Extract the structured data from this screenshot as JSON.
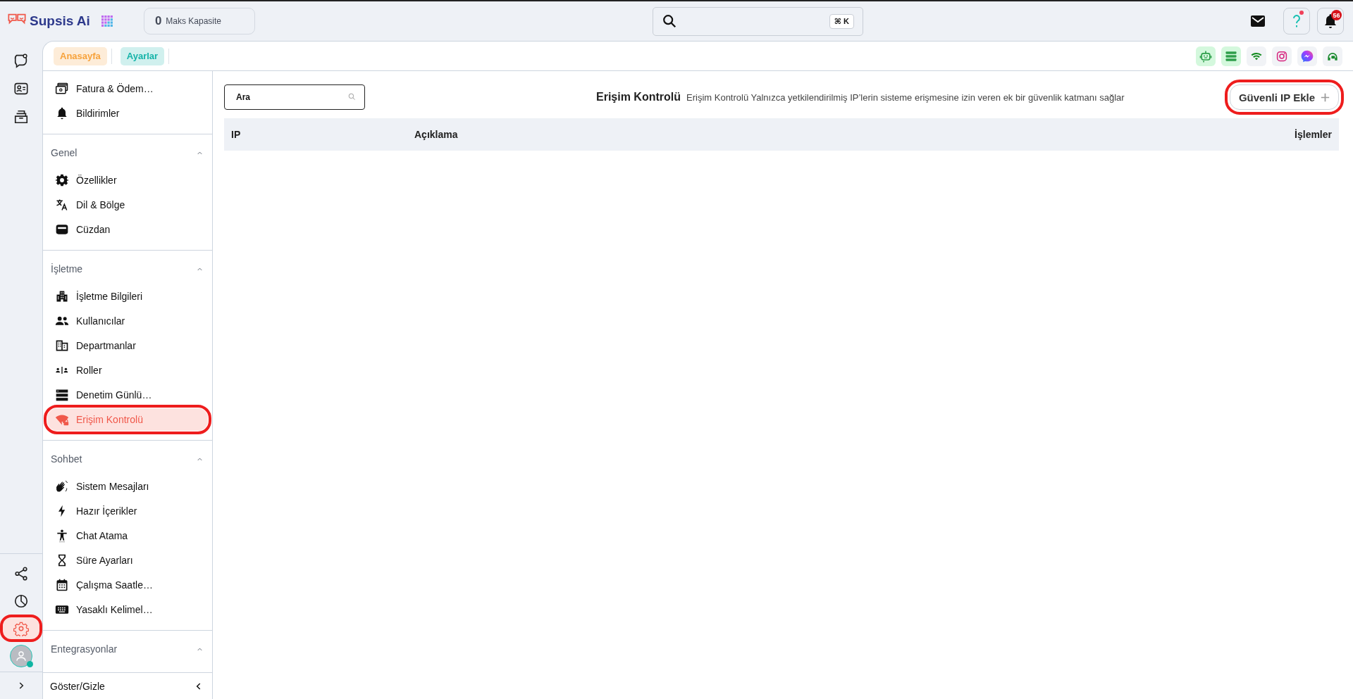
{
  "brand": {
    "name": "Supsis Ai"
  },
  "capacity": {
    "count": "0",
    "label": "Maks Kapasite"
  },
  "global_search": {
    "shortcut": "⌘ K"
  },
  "help": {
    "unread": true
  },
  "notifications": {
    "badge": "56"
  },
  "rail": {
    "top_items": [
      {
        "selected": false
      },
      {
        "selected": false
      },
      {
        "selected": false
      }
    ],
    "bottom_items": [
      {
        "selected": false,
        "highlighted": false
      },
      {
        "selected": false,
        "highlighted": false
      },
      {
        "selected": true,
        "highlighted": true
      }
    ],
    "user": {
      "online": true
    }
  },
  "breadcrumbs": [
    {
      "label": "Anasayfa",
      "color": "#f7a23b"
    },
    {
      "label": "Ayarlar",
      "color": "#14b3a8"
    }
  ],
  "channels": [
    {
      "active": true
    },
    {
      "active": true
    },
    {
      "active": false
    },
    {
      "active": false
    },
    {
      "active": false
    },
    {
      "active": false
    }
  ],
  "sidebar": {
    "pinned_items": [
      {
        "label": "Fatura & Ödem…",
        "selected": false,
        "highlighted": false
      },
      {
        "label": "Bildirimler",
        "selected": false,
        "highlighted": false
      }
    ],
    "sections": [
      {
        "title": "Genel",
        "expanded": true,
        "items": [
          {
            "label": "Özellikler",
            "selected": false,
            "highlighted": false
          },
          {
            "label": "Dil & Bölge",
            "selected": false,
            "highlighted": false
          },
          {
            "label": "Cüzdan",
            "selected": false,
            "highlighted": false
          }
        ]
      },
      {
        "title": "İşletme",
        "expanded": true,
        "items": [
          {
            "label": "İşletme Bilgileri",
            "selected": false,
            "highlighted": false
          },
          {
            "label": "Kullanıcılar",
            "selected": false,
            "highlighted": false
          },
          {
            "label": "Departmanlar",
            "selected": false,
            "highlighted": false
          },
          {
            "label": "Roller",
            "selected": false,
            "highlighted": false
          },
          {
            "label": "Denetim Günlü…",
            "selected": false,
            "highlighted": false
          },
          {
            "label": "Erişim Kontrolü",
            "selected": true,
            "highlighted": true
          }
        ]
      },
      {
        "title": "Sohbet",
        "expanded": true,
        "items": [
          {
            "label": "Sistem Mesajları",
            "selected": false,
            "highlighted": false
          },
          {
            "label": "Hazır İçerikler",
            "selected": false,
            "highlighted": false
          },
          {
            "label": "Chat Atama",
            "selected": false,
            "highlighted": false
          },
          {
            "label": "Süre Ayarları",
            "selected": false,
            "highlighted": false
          },
          {
            "label": "Çalışma Saatle…",
            "selected": false,
            "highlighted": false
          },
          {
            "label": "Yasaklı Kelimel…",
            "selected": false,
            "highlighted": false
          }
        ]
      },
      {
        "title": "Entegrasyonlar",
        "expanded": true
      }
    ],
    "toggle": {
      "label": "Göster/Gizle"
    }
  },
  "page": {
    "search": {
      "placeholder": "Ara"
    },
    "title": "Erişim Kontrolü",
    "description": "Erişim Kontrolü Yalnızca yetkilendirilmiş IP’lerin sisteme erişmesine izin veren ek bir güvenlik katmanı sağlar",
    "add_button": {
      "label": "Güvenli IP Ekle",
      "highlighted": true
    }
  },
  "table": {
    "columns": [
      "IP",
      "Açıklama",
      "İşlemler"
    ]
  }
}
